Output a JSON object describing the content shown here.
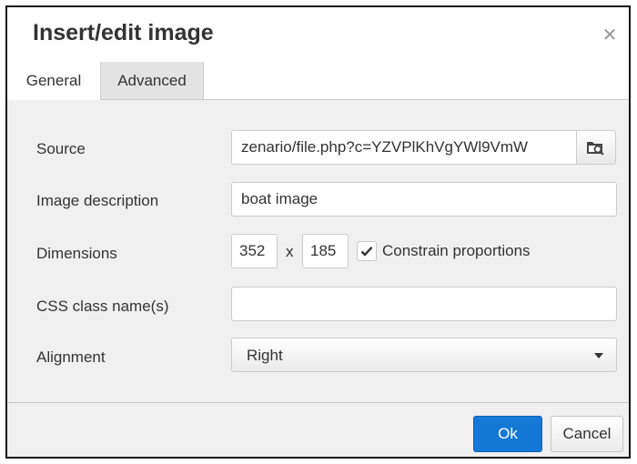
{
  "dialog": {
    "title": "Insert/edit image",
    "close_icon": "close-icon"
  },
  "tabs": [
    {
      "label": "General",
      "active": true
    },
    {
      "label": "Advanced",
      "active": false
    }
  ],
  "form": {
    "source": {
      "label": "Source",
      "value": "zenario/file.php?c=YZVPlKhVgYWl9VmW",
      "browse_icon": "browse-folder-icon"
    },
    "description": {
      "label": "Image description",
      "value": "boat image"
    },
    "dimensions": {
      "label": "Dimensions",
      "width": "352",
      "separator": "x",
      "height": "185",
      "constrain_label": "Constrain proportions",
      "constrain_checked": true
    },
    "css_class": {
      "label": "CSS class name(s)",
      "value": ""
    },
    "alignment": {
      "label": "Alignment",
      "value": "Right"
    }
  },
  "buttons": {
    "ok": "Ok",
    "cancel": "Cancel"
  },
  "colors": {
    "primary": "#1578d6",
    "dialog_bg": "#f0f0f0"
  }
}
